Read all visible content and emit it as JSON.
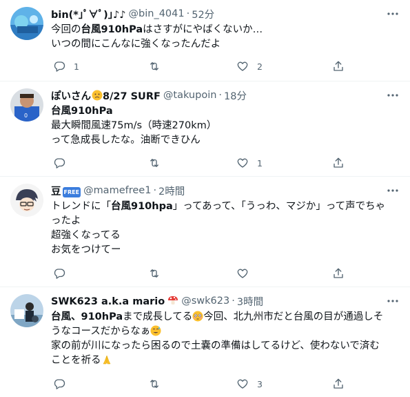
{
  "tweets": [
    {
      "name": "bin(*｣ﾟ∀ﾟ)｣♪♪",
      "handle": "@bin_4041",
      "time": "52分",
      "lines": [
        [
          {
            "t": "今回の"
          },
          {
            "t": "台風910hPa",
            "b": true
          },
          {
            "t": "はさすがにやばくないか…"
          }
        ],
        [
          {
            "t": "いつの間にこんなに強くなったんだよ"
          }
        ]
      ],
      "replies": "1",
      "retweets": "",
      "likes": "2"
    },
    {
      "name": "ぽいさん",
      "name_suffix": "8/27 SURF",
      "handle": "@takupoin",
      "time": "18分",
      "lines": [
        [
          {
            "t": "台風910hPa",
            "b": true
          }
        ],
        [
          {
            "t": "最大瞬間風速75m/s（時速270km）"
          }
        ],
        [
          {
            "t": "って急成長したな。油断できひん"
          }
        ]
      ],
      "replies": "",
      "retweets": "",
      "likes": "1"
    },
    {
      "name": "豆",
      "badge": "FREE",
      "handle": "@mamefree1",
      "time": "2時間",
      "lines": [
        [
          {
            "t": "トレンドに「"
          },
          {
            "t": "台風910hpa",
            "b": true
          },
          {
            "t": "」ってあって、「うっわ、マジか」って声でちゃ"
          }
        ],
        [
          {
            "t": "ったよ"
          }
        ],
        [
          {
            "t": "超強くなってる"
          }
        ],
        [
          {
            "t": "お気をつけてー"
          }
        ]
      ],
      "replies": "",
      "retweets": "",
      "likes": ""
    },
    {
      "name": "SWK623 a.k.a mario",
      "handle": "@swk623",
      "time": "3時間",
      "lines": [
        [
          {
            "t": "台風、910hPa",
            "b": true
          },
          {
            "t": "まで成長してる"
          },
          {
            "e": "flushed"
          },
          {
            "t": "今回、北九州市だと台風の目が通過しそ"
          }
        ],
        [
          {
            "t": "うなコースだからなぁ"
          },
          {
            "e": "sweat"
          }
        ],
        [
          {
            "t": "家の前が川になったら困るので土嚢の準備はしてるけど、使わないで済む"
          }
        ],
        [
          {
            "t": "ことを祈る"
          },
          {
            "e": "pray"
          }
        ]
      ],
      "replies": "",
      "retweets": "",
      "likes": "3"
    }
  ],
  "colors": {
    "text": "#0f1419",
    "secondary": "#536471",
    "divider": "#eff3f4"
  },
  "icons": {
    "reply": "reply-icon",
    "retweet": "retweet-icon",
    "like": "heart-icon",
    "share": "share-icon",
    "more": "more-icon"
  }
}
